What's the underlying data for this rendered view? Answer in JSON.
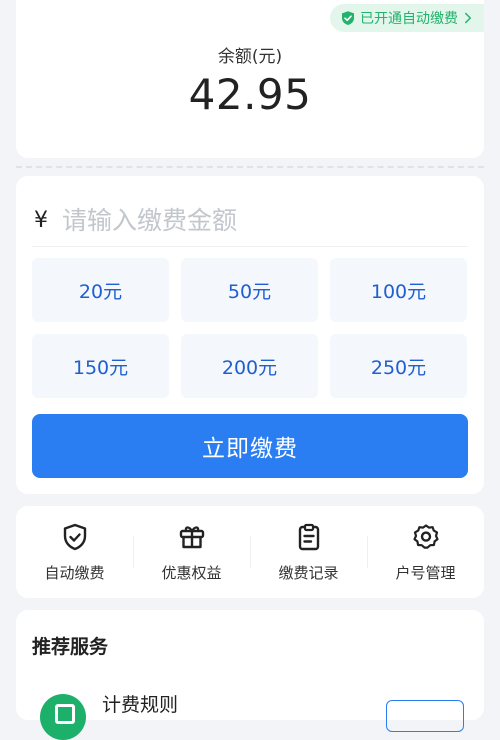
{
  "balance": {
    "auto_badge": "已开通自动缴费",
    "label": "余额(元)",
    "value": "42.95"
  },
  "payment": {
    "currency_symbol": "¥",
    "amount_placeholder": "请输入缴费金额",
    "presets": [
      "20元",
      "50元",
      "100元",
      "150元",
      "200元",
      "250元"
    ],
    "pay_button": "立即缴费"
  },
  "quick_actions": [
    {
      "label": "自动缴费",
      "icon": "shield-check-icon"
    },
    {
      "label": "优惠权益",
      "icon": "gift-icon"
    },
    {
      "label": "缴费记录",
      "icon": "clipboard-icon"
    },
    {
      "label": "户号管理",
      "icon": "gear-icon"
    }
  ],
  "services": {
    "title": "推荐服务",
    "items": [
      {
        "name": "计费规则",
        "icon": "billing-rules-icon"
      }
    ]
  },
  "colors": {
    "accent": "#2a7ef2",
    "badge_green": "#23b26b",
    "preset_text": "#1f5fcf",
    "background": "#f2f4f7"
  }
}
